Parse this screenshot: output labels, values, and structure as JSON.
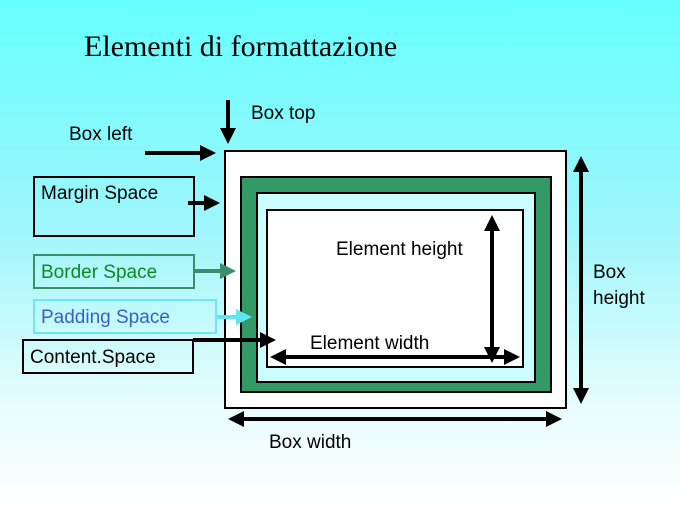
{
  "title": "Elementi di formattazione",
  "labels": {
    "box_top": "Box top",
    "box_left": "Box left",
    "box_height_line1": "Box",
    "box_height_line2": "height",
    "box_width": "Box width",
    "element_height": "Element height",
    "element_width": "Element width"
  },
  "legend": [
    {
      "id": "margin",
      "label": "Margin Space",
      "text_color": "#000000",
      "border_color": "#000000"
    },
    {
      "id": "border",
      "label": "Border Space",
      "text_color": "#0c8a1e",
      "border_color": "#3a8f6a"
    },
    {
      "id": "padding",
      "label": "Padding Space",
      "text_color": "#3a5fcd",
      "border_color": "#6de6f0"
    },
    {
      "id": "content",
      "label": "Content.Space",
      "text_color": "#000000",
      "border_color": "#000000"
    }
  ],
  "colors": {
    "margin_fill": "#ffffff",
    "border_fill": "#339966",
    "padding_fill": "#ccffff",
    "content_fill": "#ffffff",
    "arrow_black": "#000000",
    "arrow_green": "#3a8f6a",
    "arrow_cyan": "#5ee6ee"
  }
}
